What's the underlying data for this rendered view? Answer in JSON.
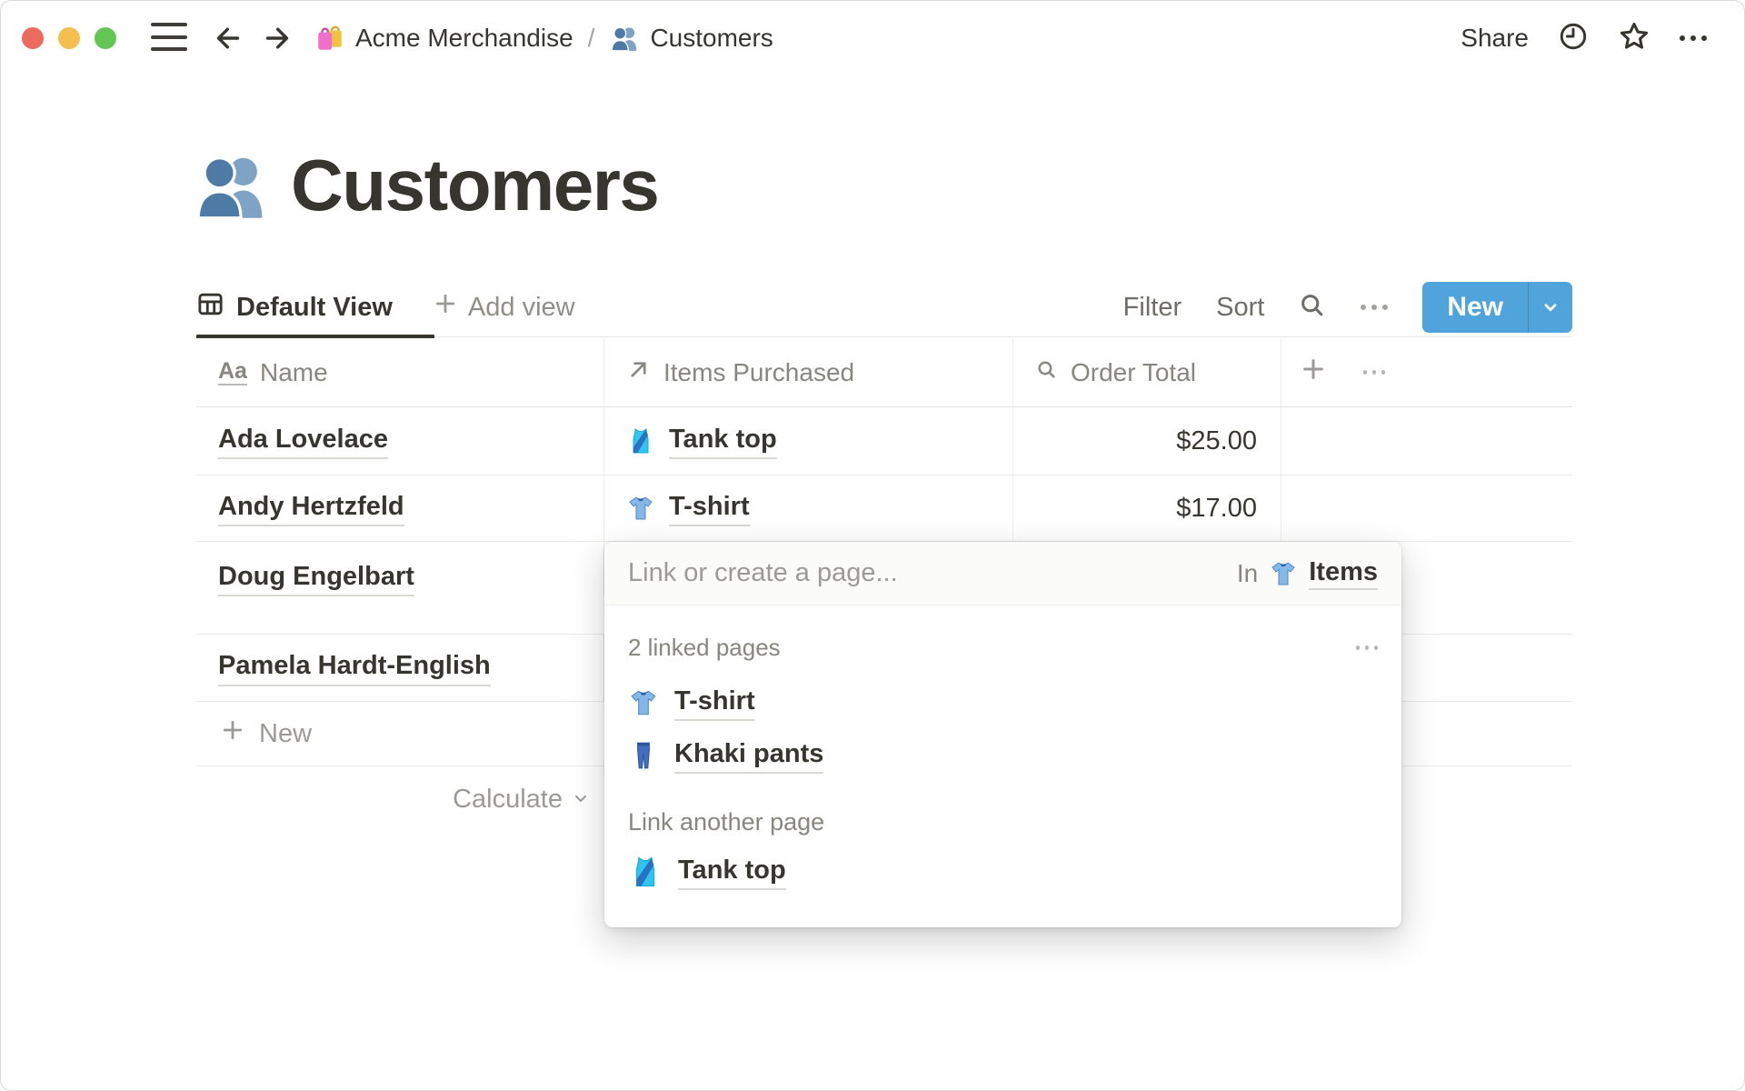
{
  "topbar": {
    "share_label": "Share",
    "breadcrumb": {
      "root": {
        "emoji": "🛍️",
        "label": "Acme Merchandise"
      },
      "separator": "/",
      "current": {
        "emoji": "👥",
        "label": "Customers"
      }
    }
  },
  "page": {
    "emoji": "👥",
    "title": "Customers"
  },
  "toolbar": {
    "active_view_label": "Default View",
    "add_view_label": "Add view",
    "filter_label": "Filter",
    "sort_label": "Sort",
    "new_button_label": "New"
  },
  "table": {
    "columns": [
      {
        "label": "Name",
        "type_icon": "text"
      },
      {
        "label": "Items Purchased",
        "type_icon": "relation"
      },
      {
        "label": "Order Total",
        "type_icon": "rollup"
      }
    ],
    "rows": [
      {
        "name": "Ada Lovelace",
        "item_emoji": "🎽",
        "item": "Tank top",
        "total": "$25.00"
      },
      {
        "name": "Andy Hertzfeld",
        "item_emoji": "👕",
        "item": "T-shirt",
        "total": "$17.00"
      },
      {
        "name": "Doug Engelbart",
        "item_emoji": "",
        "item": "",
        "total": ""
      },
      {
        "name": "Pamela Hardt-English",
        "item_emoji": "",
        "item": "",
        "total": ""
      }
    ],
    "new_row_label": "New",
    "calculate_label": "Calculate"
  },
  "popup": {
    "placeholder": "Link or create a page...",
    "in_label": "In",
    "in_target": {
      "emoji": "👕",
      "label": "Items"
    },
    "linked_pages_label": "2 linked pages",
    "linked_pages": [
      {
        "emoji": "👕",
        "label": "T-shirt"
      },
      {
        "emoji": "👖",
        "label": "Khaki pants"
      }
    ],
    "link_another_label": "Link another page",
    "suggestions": [
      {
        "emoji": "🎽",
        "label": "Tank top"
      }
    ]
  },
  "colors": {
    "accent_blue": "#4FA4DB",
    "text_primary": "#37352F"
  }
}
